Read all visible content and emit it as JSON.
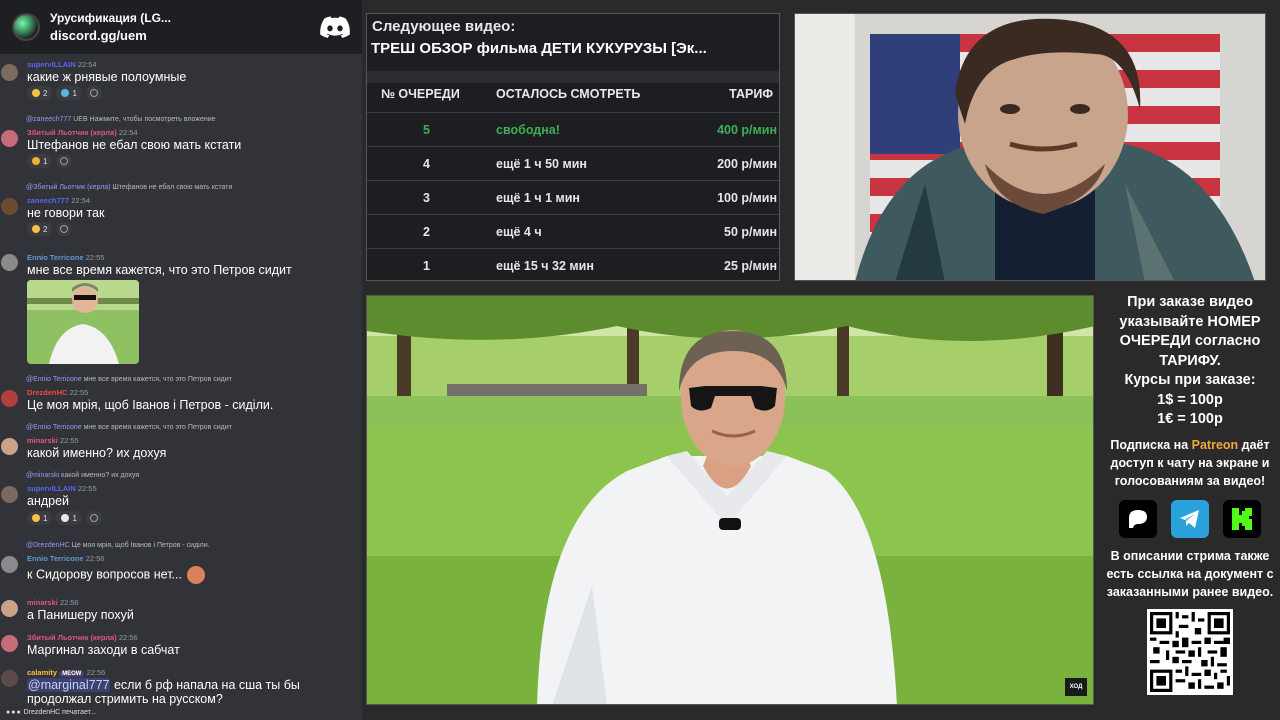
{
  "chat": {
    "server_name": "Урусификация (LG...",
    "server_link": "discord.gg/uem",
    "messages": [
      {
        "id": "m1",
        "reply": "",
        "author": "supervILLAIN",
        "time": "22:54",
        "text": "какие ж рнявые полоумные",
        "reactions": [
          "2",
          "1"
        ]
      },
      {
        "id": "m2",
        "reply_author": "@zaneech777",
        "reply": "UEB  Нажмите, чтобы посмотреть вложение",
        "author": "Збитый Льотчик (керла)",
        "time": "22:54",
        "text": "Штефанов не ебал свою мать кстати",
        "reactions": [
          "1"
        ]
      },
      {
        "id": "m3",
        "reply_author": "@Збитый Льотчик (керла)",
        "reply": "Штефанов не ебал свою мать кстати",
        "author": "zaneech777",
        "time": "22:54",
        "text": "не говори так",
        "reactions": [
          "2"
        ]
      },
      {
        "id": "m4",
        "author": "Ennio Terricone",
        "time": "22:55",
        "text": "мне все время кажется, что это Петров сидит"
      },
      {
        "id": "m5",
        "reply_author": "@Ennio Terricone",
        "reply": "мне все время кажется, что это Петров сидит",
        "author": "DrezdenHC",
        "time": "22:55",
        "text": "Це моя мрія, щоб Іванов і Петров - сиділи."
      },
      {
        "id": "m6",
        "reply_author": "@Ennio Terricone",
        "reply": "мне все время кажется, что это Петров сидит",
        "author": "minarski",
        "time": "22:55",
        "text": "какой именно? их дохуя"
      },
      {
        "id": "m7",
        "reply_author": "@minarski",
        "reply": "какой именно? их дохуя",
        "author": "supervILLAIN",
        "time": "22:55",
        "text": "андрей",
        "reactions": [
          "1",
          "1"
        ]
      },
      {
        "id": "m8",
        "reply_author": "@DrezdenHC",
        "reply": "Це моя мрія, щоб Іванов і Петров - сиділи.",
        "author": "Ennio Terricone",
        "time": "22:56",
        "text": "к Сидорову вопросов нет..."
      },
      {
        "id": "m9",
        "author": "minarski",
        "time": "22:56",
        "text": "а Панишеру похуй"
      },
      {
        "id": "m10",
        "author": "Збитый Льотчик (керла)",
        "time": "22:56",
        "text": "Маргинал заходи в сабчат"
      },
      {
        "id": "m11",
        "author": "calamity",
        "badge": "MEOW",
        "time": "22:56",
        "mention": "@marginal777",
        "text": " если б рф напала на сша ты бы",
        "text2": "продолжал стримить на русском?"
      }
    ],
    "typing": "DrezdenHC печатает..."
  },
  "queue": {
    "label": "Следующее видео:",
    "title": "ТРЕШ ОБЗОР фильма ДЕТИ КУКУРУЗЫ [Эк...",
    "headers": [
      "№ ОЧЕРЕДИ",
      "ОСТАЛОСЬ СМОТРЕТЬ",
      "ТАРИФ"
    ],
    "rows": [
      {
        "n": "5",
        "left": "свободна!",
        "price": "400 р/мин",
        "free": true
      },
      {
        "n": "4",
        "left": "ещё 1 ч 50 мин",
        "price": "200 р/мин"
      },
      {
        "n": "3",
        "left": "ещё 1 ч 1 мин",
        "price": "100 р/мин"
      },
      {
        "n": "2",
        "left": "ещё 4 ч",
        "price": "50 р/мин"
      },
      {
        "n": "1",
        "left": "ещё 15 ч 32 мин",
        "price": "25 р/мин"
      }
    ]
  },
  "video": {
    "logo": "ХОД"
  },
  "info": {
    "order_text": "При заказе видео указывайте НОМЕР ОЧЕРЕДИ согласно ТАРИФУ.",
    "rates_label": "Курсы при заказе:",
    "rate_usd": "1$ = 100р",
    "rate_eur": "1€ = 100р",
    "sub_before": "Подписка на ",
    "sub_patreon": "Patreon",
    "sub_after": " даёт доступ к чату на экране и голосованиям за видео!",
    "desc_text": "В описании стрима также есть ссылка на документ с заказанными ранее видео.",
    "colors": {
      "patreon": "#f2a640",
      "telegram": "#2aa3dc",
      "kick": "#53fc18"
    }
  }
}
